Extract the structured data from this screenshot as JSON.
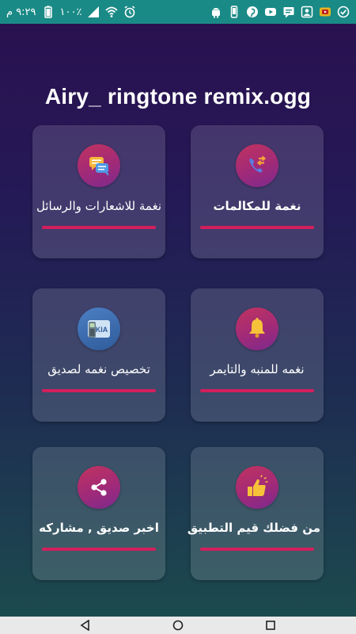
{
  "status_bar": {
    "time": "٩:٢٩ م",
    "battery_percent": "١٠٠٪",
    "left_icons": [
      "image-icon",
      "signal-icon",
      "wifi-icon",
      "alarm-icon"
    ],
    "right_icons": [
      "android-icon",
      "phone-icon",
      "pinterest-icon",
      "youtube-icon",
      "chat-icon",
      "person-icon",
      "youtube-icon-2",
      "check-circle-icon"
    ]
  },
  "header": {
    "title": "Airy_ ringtone remix.ogg"
  },
  "cards": [
    {
      "id": "calls",
      "label": "نغمة للمكالمات",
      "icon": "phone-forward-icon",
      "bold": true
    },
    {
      "id": "notifications",
      "label": "نغمة للاشعارات والرسائل",
      "icon": "messages-icon",
      "bold": false
    },
    {
      "id": "alarm",
      "label": "نغمه للمنبه والتايمر",
      "icon": "bell-icon",
      "bold": false
    },
    {
      "id": "contact",
      "label": "تخصيص نغمه لصديق",
      "icon": "nokia-phone-icon",
      "bold": false
    },
    {
      "id": "rate",
      "label": "من فضلك قيم التطبيق",
      "icon": "thumbs-up-icon",
      "bold": true
    },
    {
      "id": "share",
      "label": "اخبر صديق , مشاركه",
      "icon": "share-icon",
      "bold": true
    }
  ],
  "colors": {
    "status_bar": "#1a8a86",
    "accent_bar": "#d41f5c",
    "icon_circle": "#a02a78"
  },
  "nav_bar": {
    "buttons": [
      "back-icon",
      "home-icon",
      "recents-icon"
    ]
  }
}
